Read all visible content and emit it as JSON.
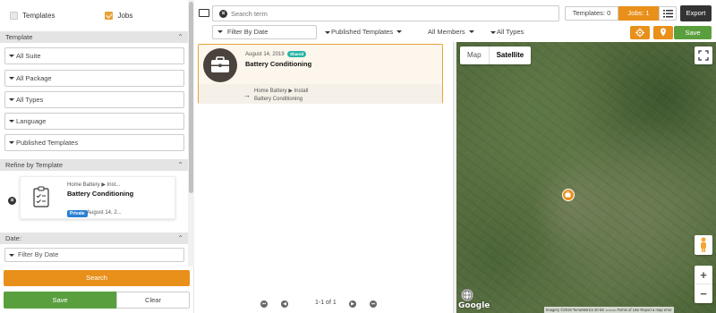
{
  "left": {
    "toggles": {
      "templates": "Templates",
      "jobs": "Jobs"
    },
    "template_section": "Template",
    "filters": [
      "All Suite",
      "All Package",
      "All Types",
      "Language",
      "Published Templates"
    ],
    "refine_section": "Refine by Template",
    "refine_card": {
      "path": "Home Battery ▶ Inst...",
      "title": "Battery Conditioning",
      "badge": "Private",
      "date": "August 14, 2..."
    },
    "date_section": "Date:",
    "date_filter": "Filter By Date",
    "search_button": "Search",
    "save_button": "Save",
    "clear_button": "Clear"
  },
  "topbar": {
    "search_placeholder": "Search term",
    "templates_count": "Templates: 0",
    "jobs_count": "Jobs: 1",
    "export": "Export",
    "filter_date": "Filter By Date",
    "published": "Published Templates",
    "members": "All Members",
    "types": "All Types",
    "save": "Save"
  },
  "job": {
    "date": "August 14, 2019",
    "badge": "Shared",
    "title": "Battery Conditioning",
    "path": "Home Battery ▶ Install",
    "sub": "Battery Conditioning"
  },
  "pager": {
    "label": "1-1 of 1"
  },
  "map": {
    "type_map": "Map",
    "type_satellite": "Satellite",
    "logo": "Google",
    "attribution": "Imagery ©2019 TerraMetrics   20 km ▭▭▭   Terms of Use   Report a map error"
  },
  "colors": {
    "accent": "#e8901a",
    "save": "#5a9f3e",
    "dark": "#333333",
    "badge_shared": "#27b4a6",
    "badge_private": "#2a7fd4"
  }
}
